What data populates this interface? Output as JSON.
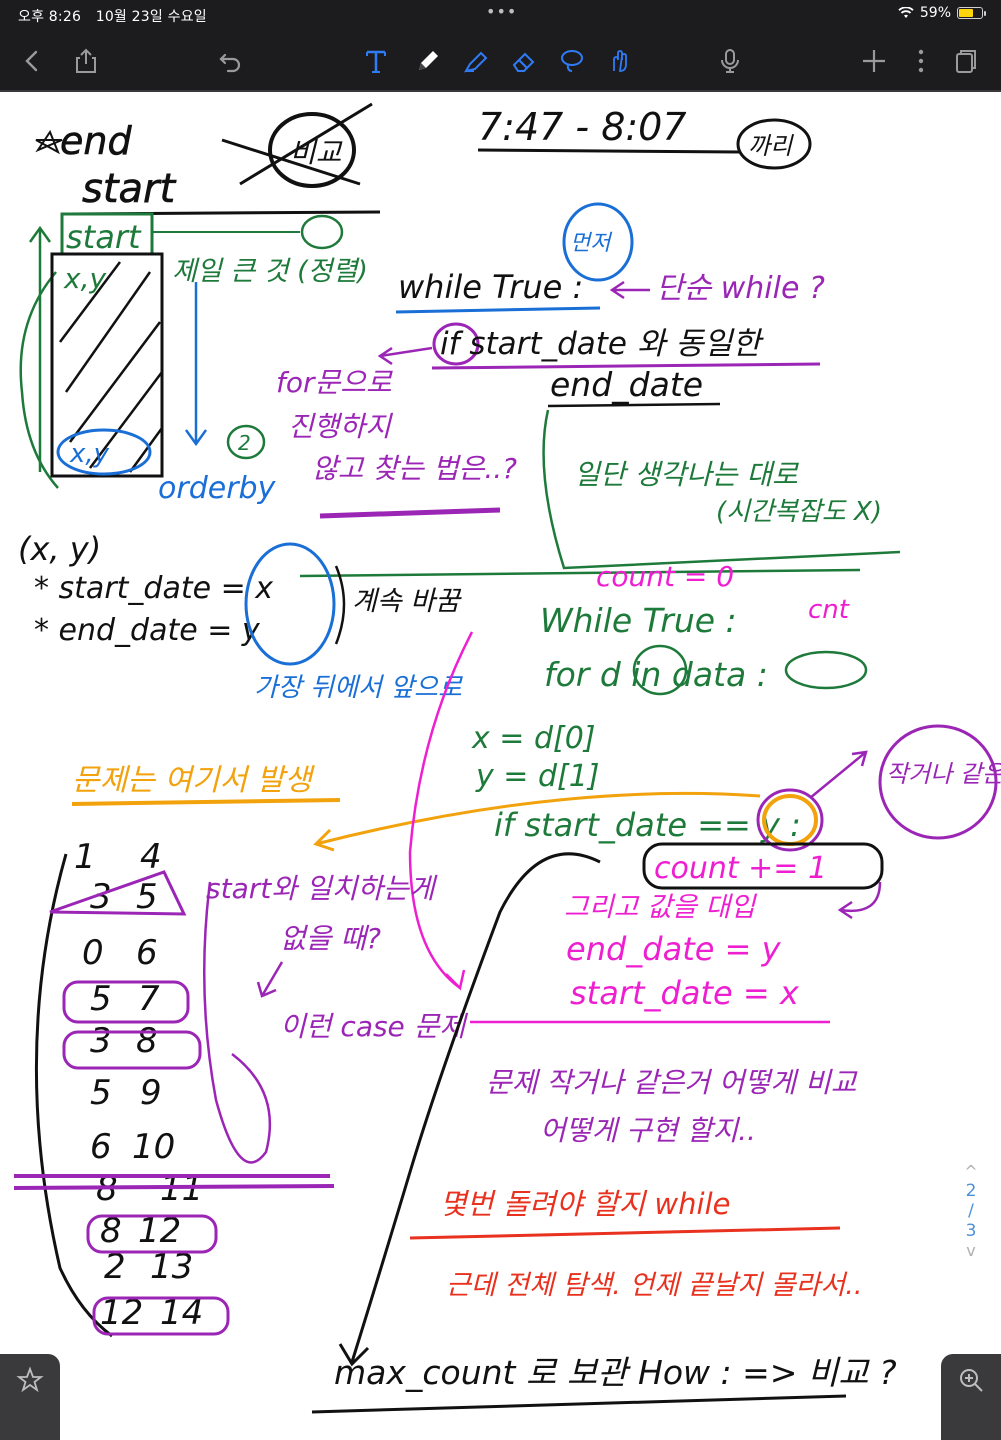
{
  "status_bar": {
    "time": "오후 8:26",
    "date": "10월 23일 수요일",
    "battery_text": "59%",
    "battery_level": 0.59
  },
  "toolbar": {
    "icons": [
      "back-icon",
      "share-icon",
      "undo-icon",
      "text-tool-icon",
      "pen-icon",
      "highlighter-icon",
      "eraser-icon",
      "lasso-icon",
      "hand-draw-icon",
      "microphone-icon",
      "add-icon",
      "more-icon",
      "pages-icon"
    ],
    "accent_color": "#2f7bf5"
  },
  "pager": {
    "up": "^",
    "current": "2",
    "separator": "/",
    "total": "3",
    "down": "v"
  },
  "notes": {
    "end_word": "end",
    "start_word": "start",
    "time_range": "7:47 - 8:07",
    "circle_compare": "비교",
    "circle_limit": "까리",
    "circle_nodes": "먼저",
    "side_start": "start",
    "xy_top": "x,y",
    "xy_bottom": "x,y",
    "note_smallest": "제일 큰 것 (정렬)",
    "note_orderby": "orderby",
    "note_for_loop_1": "for문으로",
    "note_for_loop_2": "진행하지",
    "note_for_loop_3": "않고 찾는 법은..?",
    "while_true_1": "while True :",
    "note_while_q": "단순 while ?",
    "if_line": "if start_date 와 동일한",
    "end_date": "end_date",
    "note_think_1": "일단 생각나는 대로",
    "note_think_2": "(시간복잡도 X)",
    "count_init": "count = 0",
    "cnt": "cnt",
    "xy_pair": "(x, y)",
    "start_assign": "* start_date = x",
    "end_assign": "* end_date = y",
    "note_continue": "계속 바꿈",
    "note_most_front": "가장 뒤에서 앞으로",
    "while_true_2": "While True :",
    "for_line": "for d in data :",
    "x_line": "x = d[0]",
    "y_line": "y = d[1]",
    "if_start": "if start_date == y :",
    "note_smaller_equal": "작거나 같은 것",
    "count_inc": "count += 1",
    "note_problem": "문제는 여기서 발생",
    "note_no_match_1": "start와 일치하는게",
    "note_no_match_2": "없을 때?",
    "note_then_update": "그리고 값을 대입",
    "end_update": "end_date = y",
    "start_update": "start_date = x",
    "note_case": "이런 case 문제",
    "note_compare_1": "문제 작거나 같은거 어떻게 비교",
    "note_compare_2": "어떻게 구현 할지..",
    "note_when_stop_1": "몇번 돌려야 할지 while",
    "note_when_stop_2": "근데 전체 탐색. 언제 끝날지 몰라서..",
    "max_count": "max_count 로 보관 How : => 비교 ?",
    "pairs": [
      [
        "1",
        "4"
      ],
      [
        "3",
        "5"
      ],
      [
        "0",
        "6"
      ],
      [
        "5",
        "7"
      ],
      [
        "3",
        "8"
      ],
      [
        "5",
        "9"
      ],
      [
        "6",
        "10"
      ],
      [
        "8",
        "11"
      ],
      [
        "8",
        "12"
      ],
      [
        "2",
        "13"
      ],
      [
        "12",
        "14"
      ]
    ]
  },
  "colors": {
    "black": "#111111",
    "green": "#1e7a3a",
    "blue": "#1a6fd6",
    "purple": "#9b26b6",
    "magenta": "#ee1fd0",
    "orange": "#f2a20c",
    "red": "#e8311e",
    "toolbar_bg": "#1c1c1e"
  }
}
